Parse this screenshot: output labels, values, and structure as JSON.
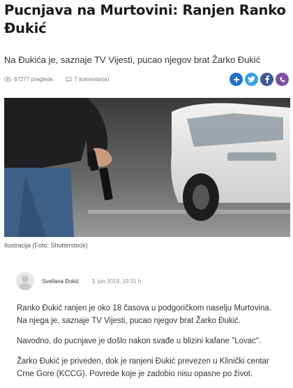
{
  "article": {
    "title": "Pucnjava na Murtovini: Ranjen Ranko Đukić",
    "lead": "Na Đukića je, saznaje TV Vijesti, pucao njegov brat Žarko Đukić",
    "views": "67277 pregleda",
    "comments": "7 komentar(a)",
    "caption": "Ilustracija (Foto: Shutterstock)",
    "author": "Svetlana Đokić",
    "date": "3. jun 2019, 19:31 h",
    "paragraphs": [
      "Ranko Đukić ranjen je oko 18 časova u podgoričkom naselju Murtovina. Na njega je, saznaje TV Vijesti, pucao njegov brat Žarko Đukić.",
      "Navodno, do pucnjave je došlo nakon svađe u blizini kafane \"Lovac\".",
      "Žarko Đukić je priveden, dok je ranjeni Đukić prevezen u Klinički centar Crne Gore (KCCG). Povrede koje je zadobio nisu opasne po život."
    ]
  },
  "share": [
    {
      "icon": "plus-icon",
      "color": "#1e6fd0"
    },
    {
      "icon": "twitter-icon",
      "color": "#35a2e8"
    },
    {
      "icon": "facebook-icon",
      "color": "#3b5998"
    },
    {
      "icon": "viber-icon",
      "color": "#7d51a1"
    }
  ],
  "icons": {
    "views": "eye-icon",
    "comments": "comment-icon"
  }
}
